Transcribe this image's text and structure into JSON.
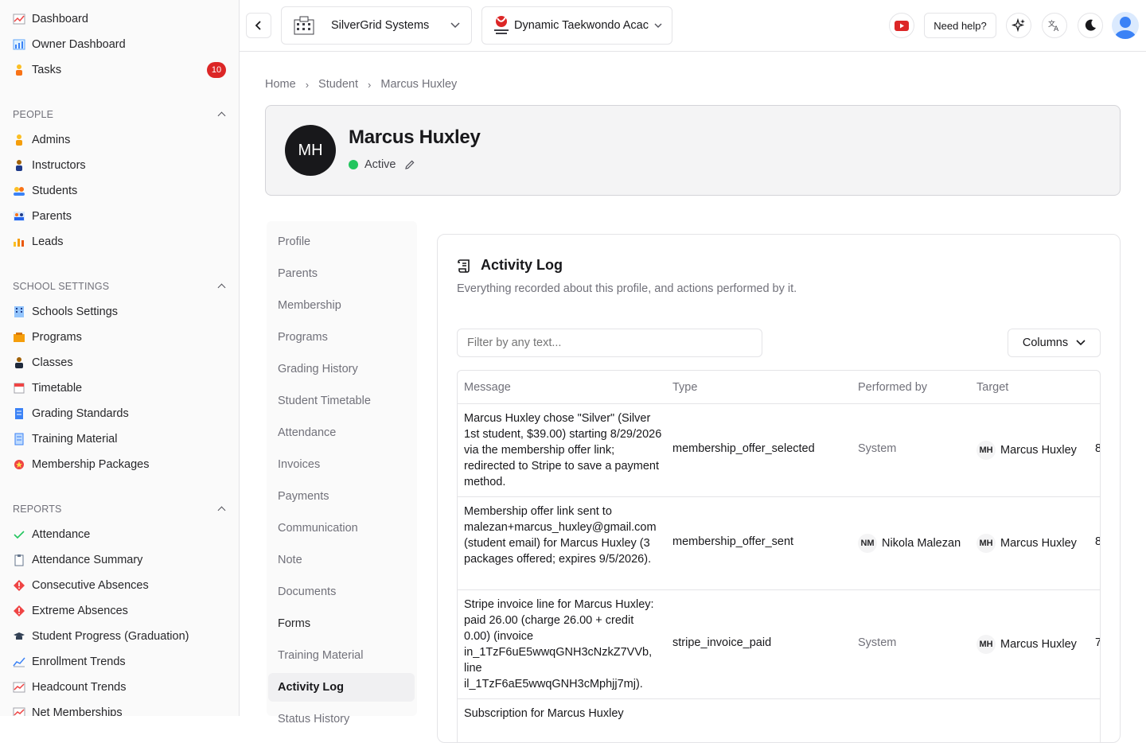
{
  "sidebar": {
    "top_items": [
      {
        "label": "Dashboard",
        "icon": "dashboard-icon"
      },
      {
        "label": "Owner Dashboard",
        "icon": "owner-dashboard-icon"
      },
      {
        "label": "Tasks",
        "icon": "tasks-icon",
        "badge": "10"
      }
    ],
    "sections": [
      {
        "title": "PEOPLE",
        "items": [
          "Admins",
          "Instructors",
          "Students",
          "Parents",
          "Leads"
        ]
      },
      {
        "title": "SCHOOL SETTINGS",
        "items": [
          "Schools Settings",
          "Programs",
          "Classes",
          "Timetable",
          "Grading Standards",
          "Training Material",
          "Membership Packages"
        ]
      },
      {
        "title": "REPORTS",
        "items": [
          "Attendance",
          "Attendance Summary",
          "Consecutive Absences",
          "Extreme Absences",
          "Student Progress (Graduation)",
          "Enrollment Trends",
          "Headcount Trends",
          "Net Memberships"
        ]
      }
    ]
  },
  "topbar": {
    "org_select": "SilverGrid Systems",
    "school_select": "Dynamic Taekwondo Acac",
    "help_label": "Need help?",
    "colors": {
      "youtube": "#dc2626"
    }
  },
  "breadcrumb": [
    "Home",
    "Student",
    "Marcus Huxley"
  ],
  "profile": {
    "initials": "MH",
    "name": "Marcus Huxley",
    "status": "Active",
    "status_color": "#22c55e"
  },
  "subnav": [
    "Profile",
    "Parents",
    "Membership",
    "Programs",
    "Grading History",
    "Student Timetable",
    "Attendance",
    "Invoices",
    "Payments",
    "Communication",
    "Note",
    "Documents",
    "Forms",
    "Training Material",
    "Activity Log",
    "Status History"
  ],
  "activity": {
    "title": "Activity Log",
    "subtitle": "Everything recorded about this profile, and actions performed by it.",
    "filter_placeholder": "Filter by any text...",
    "columns_label": "Columns",
    "headers": [
      "Message",
      "Type",
      "Performed by",
      "Target"
    ],
    "rows": [
      {
        "message": "Marcus Huxley chose \"Silver\" (Silver 1st student, $39.00) starting 8/29/2026 via the membership offer link; redirected to Stripe to save a payment method.",
        "type": "membership_offer_selected",
        "performed_by": "System",
        "performed_initials": "",
        "target_initials": "MH",
        "target": "Marcus Huxley",
        "extra": "8"
      },
      {
        "message": "Membership offer link sent to malezan+marcus_huxley@gmail.com (student email) for Marcus Huxley (3 packages offered; expires 9/5/2026).",
        "type": "membership_offer_sent",
        "performed_by": "Nikola Malezan",
        "performed_initials": "NM",
        "target_initials": "MH",
        "target": "Marcus Huxley",
        "extra": "8"
      },
      {
        "message": "Stripe invoice line for Marcus Huxley: paid 26.00 (charge 26.00 + credit 0.00) (invoice in_1TzF6uE5wwqGNH3cNzkZ7VVb, line il_1TzF6aE5wwqGNH3cMphjj7mj).",
        "type": "stripe_invoice_paid",
        "performed_by": "System",
        "performed_initials": "",
        "target_initials": "MH",
        "target": "Marcus Huxley",
        "extra": "7"
      },
      {
        "message": "Subscription for Marcus Huxley",
        "type": "",
        "performed_by": "",
        "performed_initials": "",
        "target_initials": "",
        "target": "",
        "extra": ""
      }
    ]
  }
}
